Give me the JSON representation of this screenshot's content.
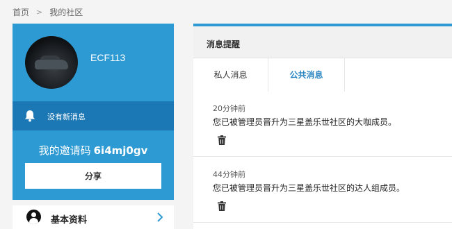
{
  "breadcrumb": {
    "home": "首页",
    "separator": ">",
    "current": "我的社区"
  },
  "profile": {
    "username": "ECF113",
    "avatar_icon": "avatar-photo"
  },
  "notice": {
    "icon": "bell-icon",
    "text": "没有新消息"
  },
  "invite": {
    "label": "我的邀请码",
    "code": "6i4mj0gv",
    "share_label": "分享"
  },
  "menu": {
    "basic_info_label": "基本资料",
    "basic_info_icon": "person-icon",
    "chevron": "chevron-right-icon"
  },
  "messages_panel": {
    "title": "消息提醒",
    "tabs": [
      {
        "label": "私人消息",
        "active": false
      },
      {
        "label": "公共消息",
        "active": true
      }
    ],
    "items": [
      {
        "time": "20分钟前",
        "text": "您已被管理员晋升为三星盖乐世社区的大咖成员。",
        "delete_icon": "trash-icon"
      },
      {
        "time": "44分钟前",
        "text": "您已被管理员晋升为三星盖乐世社区的达人组成员。",
        "delete_icon": "trash-icon"
      }
    ]
  },
  "colors": {
    "primary": "#2e9ad3",
    "notice_bar": "#1c78b4",
    "active_tab": "#2e86c1",
    "background": "#f4f4f4"
  }
}
